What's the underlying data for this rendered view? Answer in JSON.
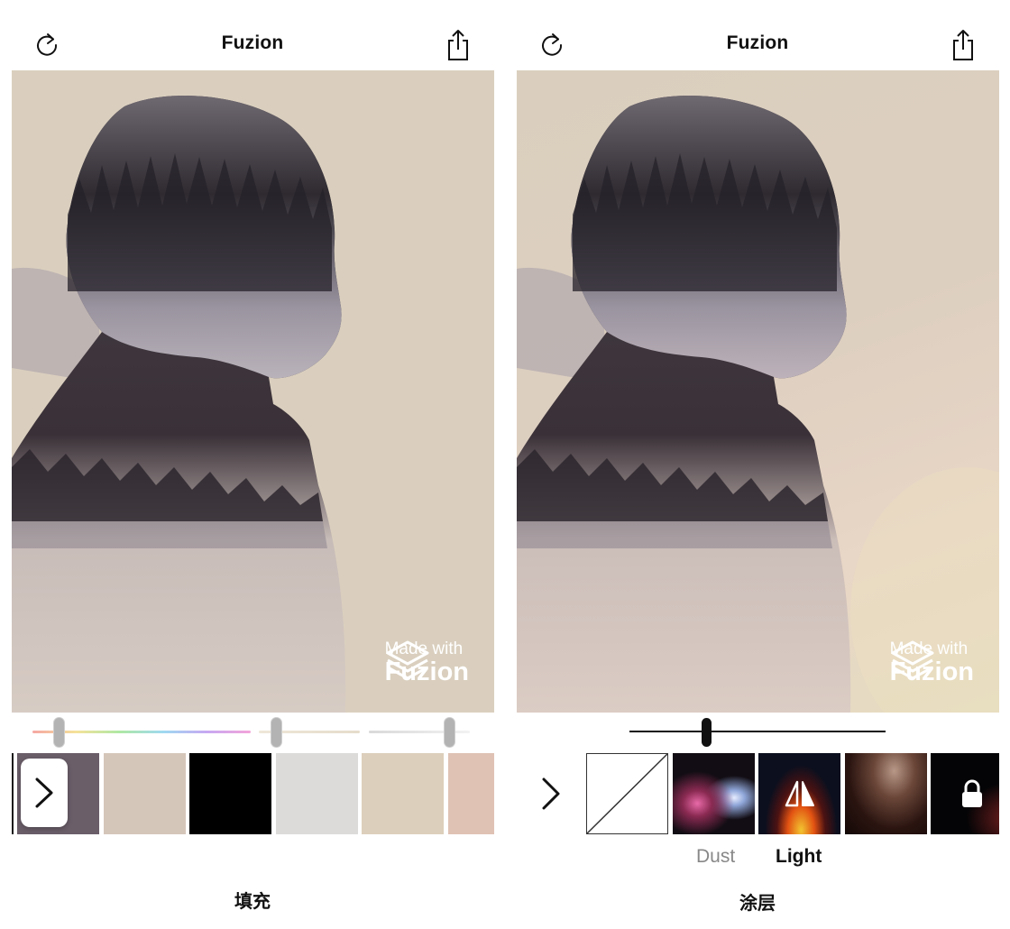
{
  "left": {
    "title": "Fuzion",
    "watermark": {
      "line1": "Made with",
      "line2": "Fuzion"
    },
    "caption": "填充",
    "sliders": {
      "hue": 0.12,
      "saturation": 0.17,
      "lightness": 0.8
    },
    "swatch_colors": [
      "#6a5e69",
      "#d5c6ba",
      "#000000",
      "#dcdbd9",
      "#dccfbb",
      "#dfc2b4"
    ]
  },
  "right": {
    "title": "Fuzion",
    "watermark": {
      "line1": "Made with",
      "line2": "Fuzion"
    },
    "caption": "涂层",
    "opacity": 0.3,
    "overlays": [
      {
        "name": "none",
        "icon": "none-diagonal-icon"
      },
      {
        "name": "Dust",
        "icon": ""
      },
      {
        "name": "Light",
        "icon": "flip-icon"
      },
      {
        "name": "",
        "icon": ""
      },
      {
        "name": "",
        "icon": "lock-icon"
      }
    ],
    "labels": {
      "dust": "Dust",
      "light": "Light"
    }
  }
}
